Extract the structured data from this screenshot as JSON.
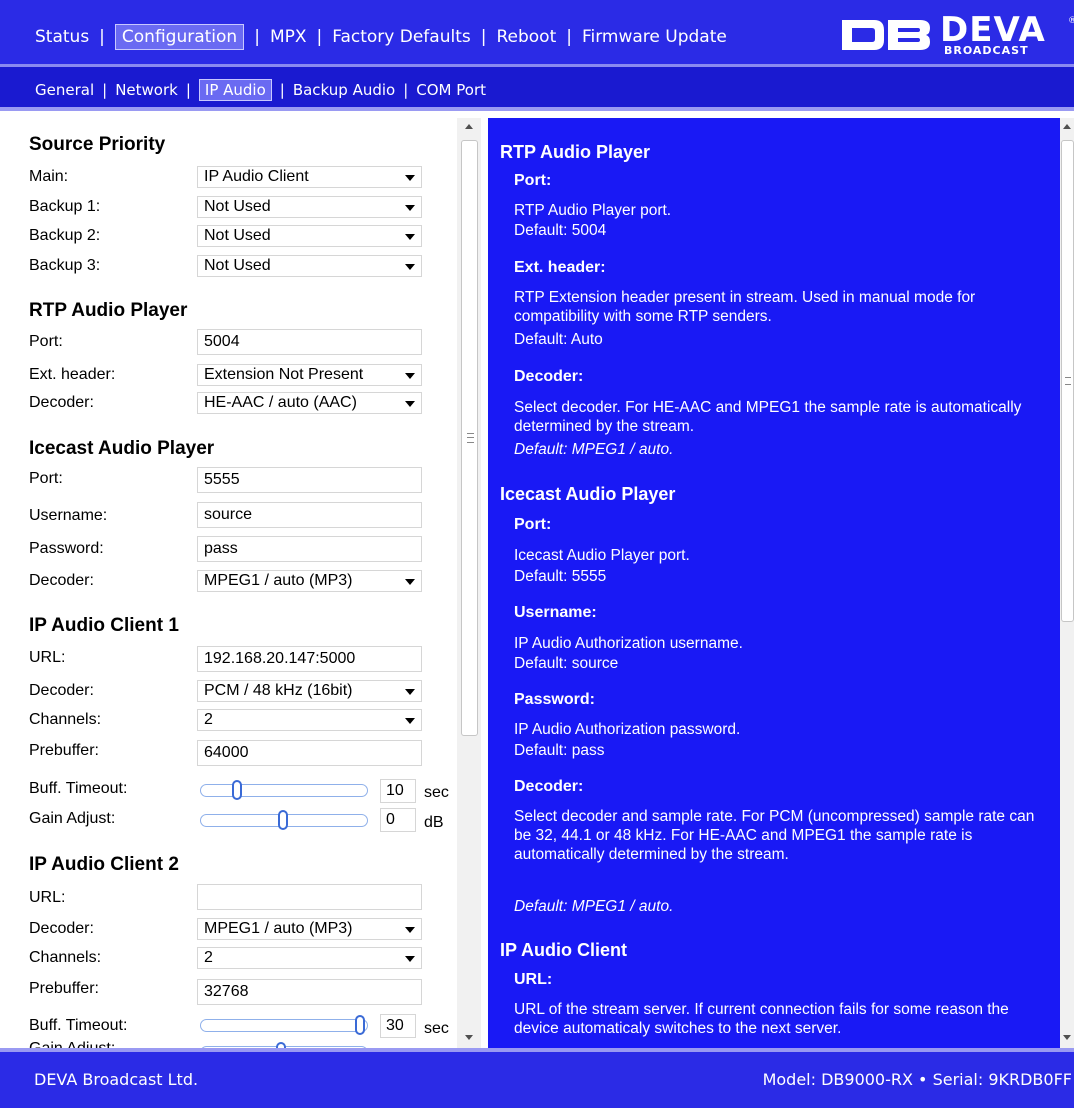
{
  "topnav": {
    "items": [
      "Status",
      "Configuration",
      "MPX",
      "Factory Defaults",
      "Reboot",
      "Firmware Update"
    ],
    "logo_text": "DEVA",
    "logo_sub": "BROADCAST",
    "logo_reg": "®"
  },
  "subnav": {
    "items": [
      "General",
      "Network",
      "IP Audio",
      "Backup Audio",
      "COM Port"
    ]
  },
  "settings": {
    "source_priority": {
      "title": "Source Priority",
      "main_label": "Main:",
      "main_value": "IP Audio Client",
      "backup1_label": "Backup 1:",
      "backup1_value": "Not Used",
      "backup2_label": "Backup 2:",
      "backup2_value": "Not Used",
      "backup3_label": "Backup 3:",
      "backup3_value": "Not Used"
    },
    "rtp": {
      "title": "RTP Audio Player",
      "port_label": "Port:",
      "port_value": "5004",
      "ext_label": "Ext. header:",
      "ext_value": "Extension Not Present",
      "decoder_label": "Decoder:",
      "decoder_value": "HE-AAC / auto (AAC)"
    },
    "icecast": {
      "title": "Icecast Audio Player",
      "port_label": "Port:",
      "port_value": "5555",
      "user_label": "Username:",
      "user_value": "source",
      "pass_label": "Password:",
      "pass_value": "pass",
      "decoder_label": "Decoder:",
      "decoder_value": "MPEG1 / auto (MP3)"
    },
    "client1": {
      "title": "IP Audio Client 1",
      "url_label": "URL:",
      "url_value": "192.168.20.147:5000",
      "decoder_label": "Decoder:",
      "decoder_value": "PCM / 48 kHz (16bit)",
      "channels_label": "Channels:",
      "channels_value": "2",
      "prebuffer_label": "Prebuffer:",
      "prebuffer_value": "64000",
      "timeout_label": "Buff. Timeout:",
      "timeout_value": "10",
      "timeout_unit": "sec",
      "timeout_level": 0.2,
      "gain_label": "Gain Adjust:",
      "gain_value": "0",
      "gain_unit": "dB",
      "gain_level": 0.5
    },
    "client2": {
      "title": "IP Audio Client 2",
      "url_label": "URL:",
      "url_value": "",
      "decoder_label": "Decoder:",
      "decoder_value": "MPEG1 / auto (MP3)",
      "channels_label": "Channels:",
      "channels_value": "2",
      "prebuffer_label": "Prebuffer:",
      "prebuffer_value": "32768",
      "timeout_label": "Buff. Timeout:",
      "timeout_value": "30",
      "timeout_unit": "sec",
      "timeout_level": 1.0,
      "gain_label": "Gain Adjust:"
    }
  },
  "help": {
    "rtp_title": "RTP Audio Player",
    "rtp_port_h": "Port:",
    "rtp_port_p1": "RTP Audio Player port.",
    "rtp_port_p2": "Default: 5004",
    "rtp_ext_h": "Ext. header:",
    "rtp_ext_p1": "RTP Extension header present in stream. Used in manual mode for compatibility with some RTP senders.",
    "rtp_ext_p2": "Default: Auto",
    "rtp_dec_h": "Decoder:",
    "rtp_dec_p1": "Select decoder. For HE-AAC and MPEG1 the sample rate is automatically determined by the stream.",
    "rtp_dec_p2": "Default: MPEG1 / auto.",
    "ice_title": "Icecast Audio Player",
    "ice_port_h": "Port:",
    "ice_port_p1": "Icecast Audio Player port.",
    "ice_port_p2": "Default: 5555",
    "ice_user_h": "Username:",
    "ice_user_p1": "IP Audio Authorization username.",
    "ice_user_p2": "Default: source",
    "ice_pass_h": "Password:",
    "ice_pass_p1": "IP Audio Authorization password.",
    "ice_pass_p2": "Default: pass",
    "ice_dec_h": "Decoder:",
    "ice_dec_p1": "Select decoder and sample rate. For PCM (uncompressed) sample rate can be 32, 44.1 or 48 kHz. For HE-AAC and MPEG1 the sample rate is automatically determined by the stream.",
    "ice_dec_p2": "Default: MPEG1 / auto.",
    "client_title": "IP Audio Client",
    "client_url_h": "URL:",
    "client_url_p1": "URL of the stream server. If current connection fails for some reason the device automaticaly switches to the next server."
  },
  "footer": {
    "company": "DEVA Broadcast Ltd.",
    "model": "Model: DB9000-RX • Serial: 9KRDB0FF"
  },
  "colors": {
    "nav_bg": "#2b2be6",
    "help_bg": "#1919f5",
    "active_tab": "#6a6af2"
  }
}
